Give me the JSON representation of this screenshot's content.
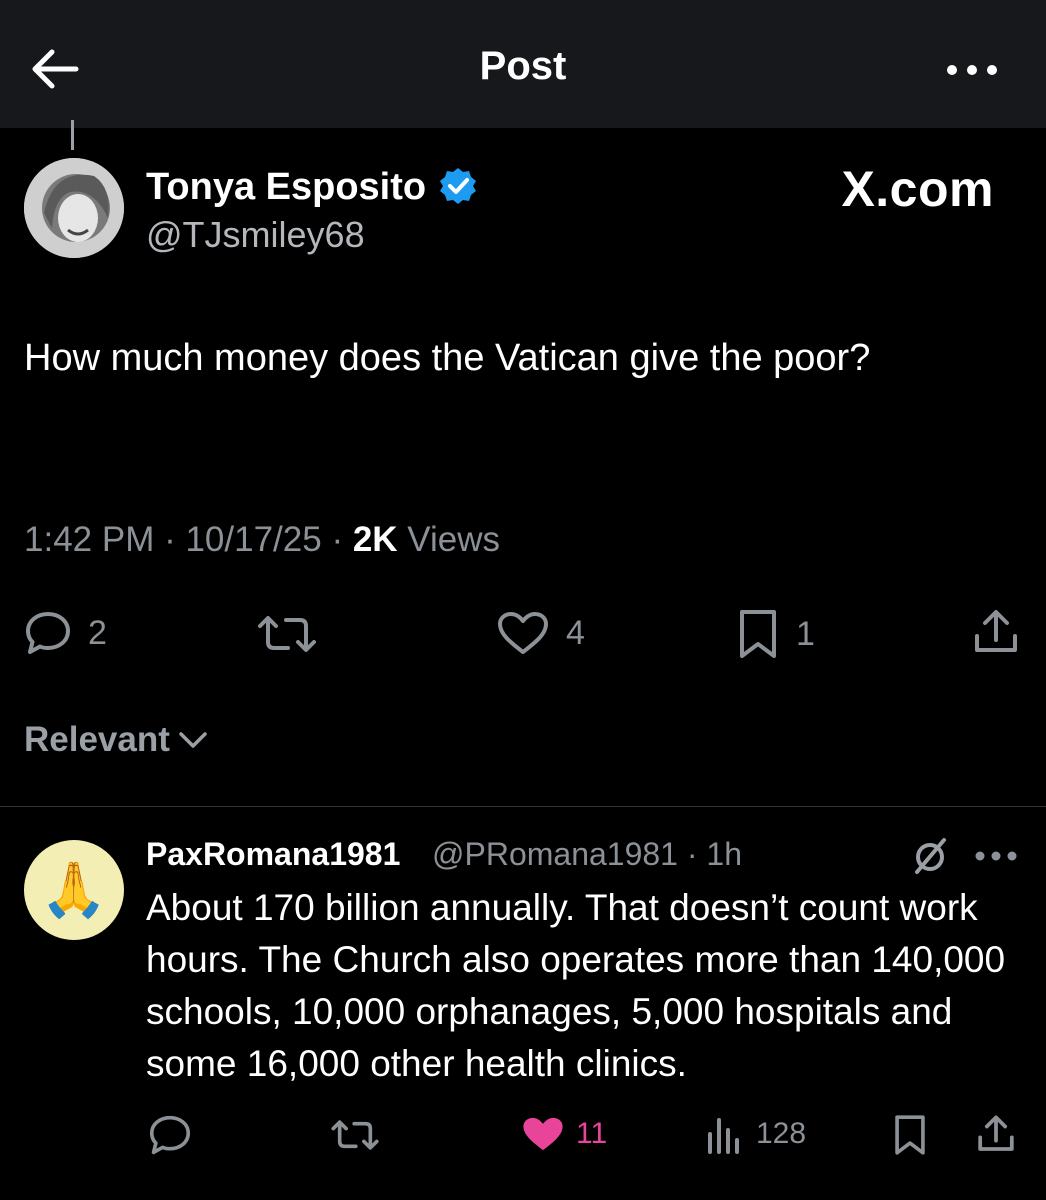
{
  "header": {
    "title": "Post"
  },
  "post": {
    "display_name": "Tonya Esposito",
    "handle": "@TJsmiley68",
    "brand": "X.com",
    "text": "How much money does the Vatican give the poor?",
    "time": "1:42 PM",
    "sep1": " · ",
    "date": "10/17/25",
    "sep2": " · ",
    "views_count": "2K",
    "views_label": " Views",
    "actions": {
      "replies": "2",
      "likes": "4",
      "bookmarks": "1"
    }
  },
  "sort": {
    "label": "Relevant"
  },
  "reply": {
    "display_name": "PaxRomana1981",
    "handle": "@PRomana1981 · 1h",
    "avatar_emoji": "🙏",
    "text": "About 170 billion annually. That doesn’t count work hours. The Church also operates more than 140,000 schools, 10,000 orphanages, 5,000 hospitals and some 16,000 other health clinics.",
    "actions": {
      "likes": "11",
      "views": "128"
    },
    "like_color": "#e8449a"
  },
  "colors": {
    "background": "#000000",
    "header_bg": "#16181c",
    "secondary_text": "#8b9196",
    "verified_blue": "#1d9bf0"
  }
}
